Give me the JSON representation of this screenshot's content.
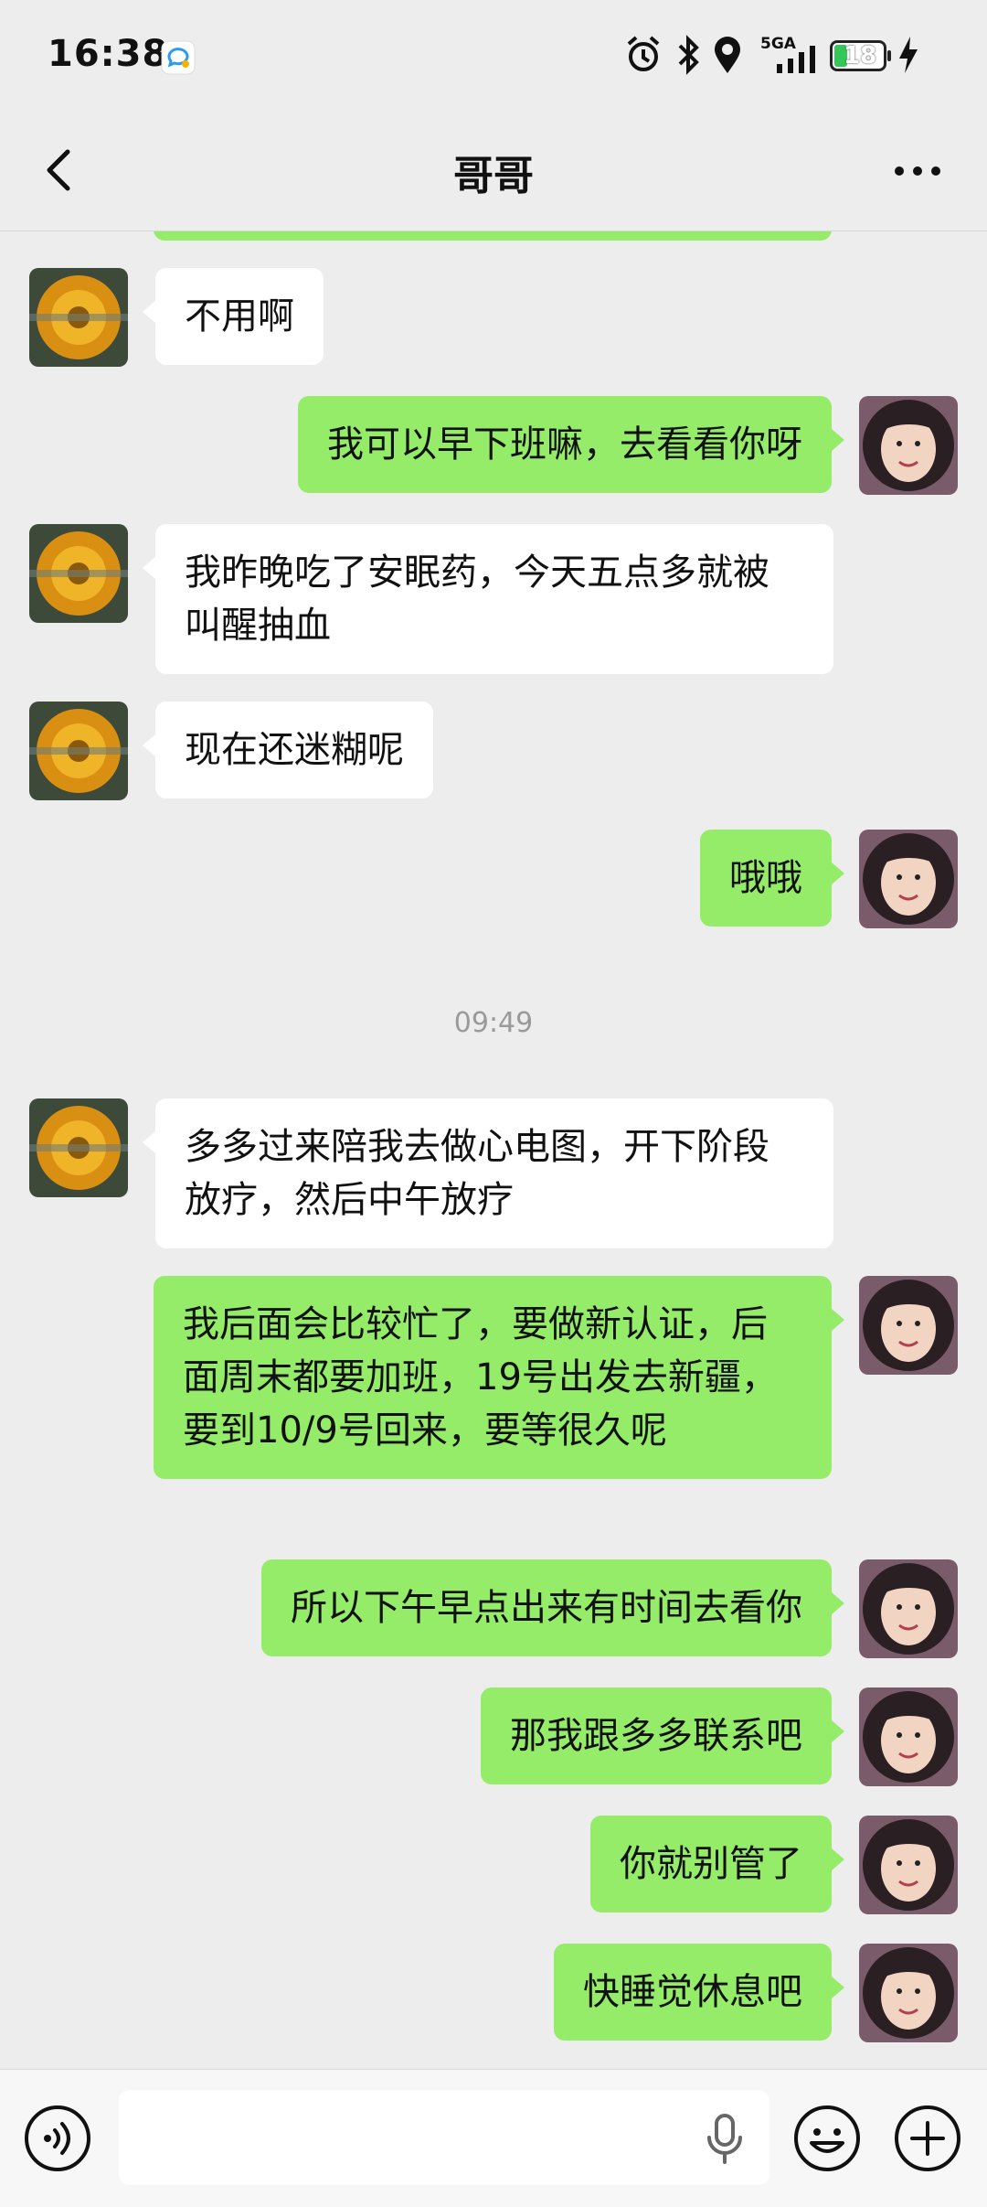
{
  "status_bar": {
    "time": "16:38",
    "network": "5GA",
    "battery": "18"
  },
  "header": {
    "title": "哥哥"
  },
  "messages": [
    {
      "side": "in",
      "text": "不用啊"
    },
    {
      "side": "out",
      "text": "我可以早下班嘛，去看看你呀"
    },
    {
      "side": "in",
      "text": "我昨晚吃了安眠药，今天五点多就被叫醒抽血"
    },
    {
      "side": "in",
      "text": "现在还迷糊呢"
    },
    {
      "side": "out",
      "text": "哦哦"
    },
    {
      "side": "time",
      "text": "09:49"
    },
    {
      "side": "in",
      "text": "多多过来陪我去做心电图，开下阶段放疗，然后中午放疗"
    },
    {
      "side": "out",
      "text": "我后面会比较忙了，要做新认证，后面周末都要加班，19号出发去新疆，要到10/9号回来，要等很久呢"
    },
    {
      "side": "out",
      "text": "所以下午早点出来有时间去看你"
    },
    {
      "side": "out",
      "text": "那我跟多多联系吧"
    },
    {
      "side": "out",
      "text": "你就别管了"
    },
    {
      "side": "out",
      "text": "快睡觉休息吧"
    }
  ],
  "input_bar": {
    "voice_icon": "voice-icon",
    "mic_icon": "microphone-icon",
    "emoji_icon": "emoji-icon",
    "plus_icon": "plus-icon",
    "value": ""
  },
  "colors": {
    "outgoing_bubble": "#95ec69",
    "incoming_bubble": "#ffffff",
    "background": "#ededed"
  }
}
